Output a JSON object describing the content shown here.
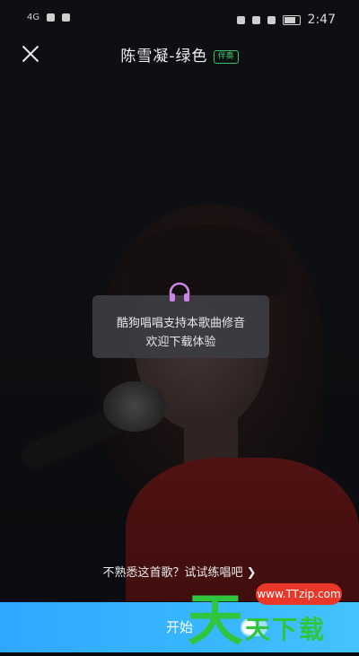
{
  "status_bar": {
    "left_text": "4G",
    "battery_label": "85",
    "time": "2:47"
  },
  "header": {
    "title": "陈雪凝-绿色",
    "badge": "伴奏"
  },
  "toast": {
    "line1": "酷狗唱唱支持本歌曲修音",
    "line2": "欢迎下载体验"
  },
  "practice_link": "不熟悉这首歌？试试练唱吧 ❯",
  "start_button": {
    "label": "开始"
  },
  "watermark": {
    "big_char": "天",
    "url": "www.TTzip.com",
    "small_text": "天下载"
  },
  "colors": {
    "accent": "#2ea8ff",
    "badge_green": "#3cc36a",
    "watermark_green": "#2fc53c",
    "watermark_red": "#e9372a"
  }
}
